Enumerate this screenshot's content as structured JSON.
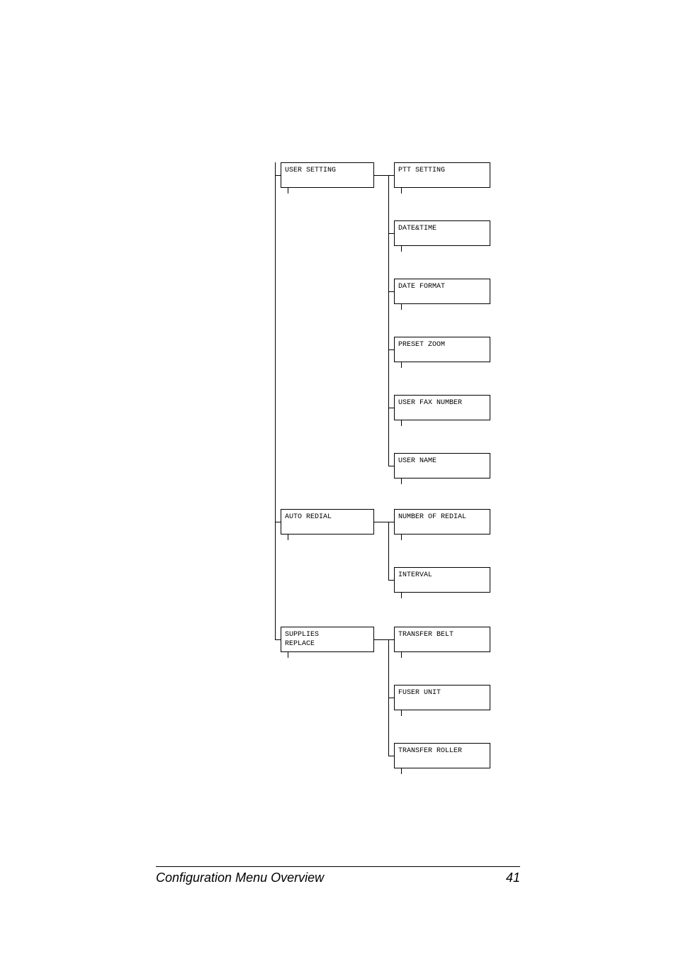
{
  "chart_data": {
    "type": "table",
    "description": "Hierarchical configuration menu tree (two levels shown)",
    "nodes": [
      {
        "id": "user_setting",
        "label": "USER SETTING",
        "children": [
          "ptt_setting",
          "date_time",
          "date_format",
          "preset_zoom",
          "user_fax_number",
          "user_name"
        ]
      },
      {
        "id": "auto_redial",
        "label": "AUTO REDIAL",
        "children": [
          "number_of_redial",
          "interval"
        ]
      },
      {
        "id": "supplies_replace",
        "label": "SUPPLIES\nREPLACE",
        "children": [
          "transfer_belt",
          "fuser_unit",
          "transfer_roller"
        ]
      },
      {
        "id": "ptt_setting",
        "label": "PTT SETTING"
      },
      {
        "id": "date_time",
        "label": "DATE&TIME"
      },
      {
        "id": "date_format",
        "label": "DATE FORMAT"
      },
      {
        "id": "preset_zoom",
        "label": "PRESET ZOOM"
      },
      {
        "id": "user_fax_number",
        "label": "USER FAX NUMBER"
      },
      {
        "id": "user_name",
        "label": "USER NAME"
      },
      {
        "id": "number_of_redial",
        "label": "NUMBER OF REDIAL"
      },
      {
        "id": "interval",
        "label": "INTERVAL"
      },
      {
        "id": "transfer_belt",
        "label": "TRANSFER BELT"
      },
      {
        "id": "fuser_unit",
        "label": "FUSER UNIT"
      },
      {
        "id": "transfer_roller",
        "label": "TRANSFER ROLLER"
      }
    ]
  },
  "tree": {
    "user_setting": {
      "label": "USER SETTING",
      "children": {
        "ptt_setting": "PTT SETTING",
        "date_time": "DATE&TIME",
        "date_format": "DATE FORMAT",
        "preset_zoom": "PRESET ZOOM",
        "user_fax_number": "USER FAX NUMBER",
        "user_name": "USER NAME"
      }
    },
    "auto_redial": {
      "label": "AUTO REDIAL",
      "children": {
        "number_of_redial": "NUMBER OF REDIAL",
        "interval": "INTERVAL"
      }
    },
    "supplies_replace": {
      "label": "SUPPLIES\nREPLACE",
      "children": {
        "transfer_belt": "TRANSFER BELT",
        "fuser_unit": "FUSER UNIT",
        "transfer_roller": "TRANSFER ROLLER"
      }
    }
  },
  "footer": {
    "title": "Configuration Menu Overview",
    "page_number": "41"
  }
}
